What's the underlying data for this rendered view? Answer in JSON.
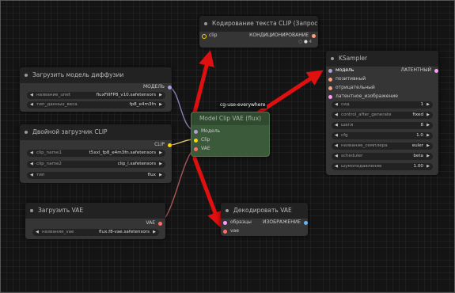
{
  "nodes": {
    "clip_text_encode": {
      "title": "Кодирование текста CLIP (Запрос)",
      "input_clip": "clip",
      "output_conditioning": "КОНДИЦИОНИРОВАНИЕ",
      "hidden_count": "4"
    },
    "load_diffusion": {
      "title": "Загрузить модель диффузии",
      "output_model": "МОДЕЛЬ",
      "widgets": [
        {
          "label": "название_unet",
          "value": "fluxFillFP8_v10.safetensors"
        },
        {
          "label": "тип_данных_веса",
          "value": "fp8_e4m3fn"
        }
      ]
    },
    "dual_clip": {
      "title": "Двойной загрузчик CLIP",
      "output_clip": "CLIP",
      "widgets": [
        {
          "label": "clip_name1",
          "value": "t5xxl_fp8_e4m3fn.safetensors"
        },
        {
          "label": "clip_name2",
          "value": "clip_l.safetensors"
        },
        {
          "label": "тип",
          "value": "flux"
        }
      ]
    },
    "load_vae": {
      "title": "Загрузить VAE",
      "output_vae": "VAE",
      "widgets": [
        {
          "label": "название_vae",
          "value": "flux.f8-vae.safetensors"
        }
      ]
    },
    "model_clip_vae": {
      "title": "Model Clip VAE (flux)",
      "overlay": "cg-use-everywhere",
      "inputs": [
        "Модель",
        "Clip",
        "VAE"
      ]
    },
    "ksampler": {
      "title": "KSampler",
      "inputs": [
        "модель",
        "позитивный",
        "отрицательный",
        "латентное_изображение"
      ],
      "output_latent": "ЛАТЕНТНЫЙ",
      "widgets": [
        {
          "label": "сид",
          "value": "1"
        },
        {
          "label": "control_after_generate",
          "value": "fixed"
        },
        {
          "label": "шаги",
          "value": "8"
        },
        {
          "label": "cfg",
          "value": "1.0"
        },
        {
          "label": "название_семплера",
          "value": "euler"
        },
        {
          "label": "scheduler",
          "value": "beta"
        },
        {
          "label": "шумоподавление",
          "value": "1.00"
        }
      ]
    },
    "vae_decode": {
      "title": "Декодировать VAE",
      "input_samples": "образцы",
      "input_vae": "vae",
      "output_image": "ИЗОБРАЖЕНИЕ"
    }
  },
  "colors": {
    "model_pin": "#b39ddb",
    "clip_pin": "#ffd500",
    "vae_pin": "#ff6e6e",
    "conditioning_pin": "#ffa07a",
    "latent_pin": "#ff9cf9",
    "arrow": "#e01010",
    "group_green": "#3a5a3a"
  }
}
